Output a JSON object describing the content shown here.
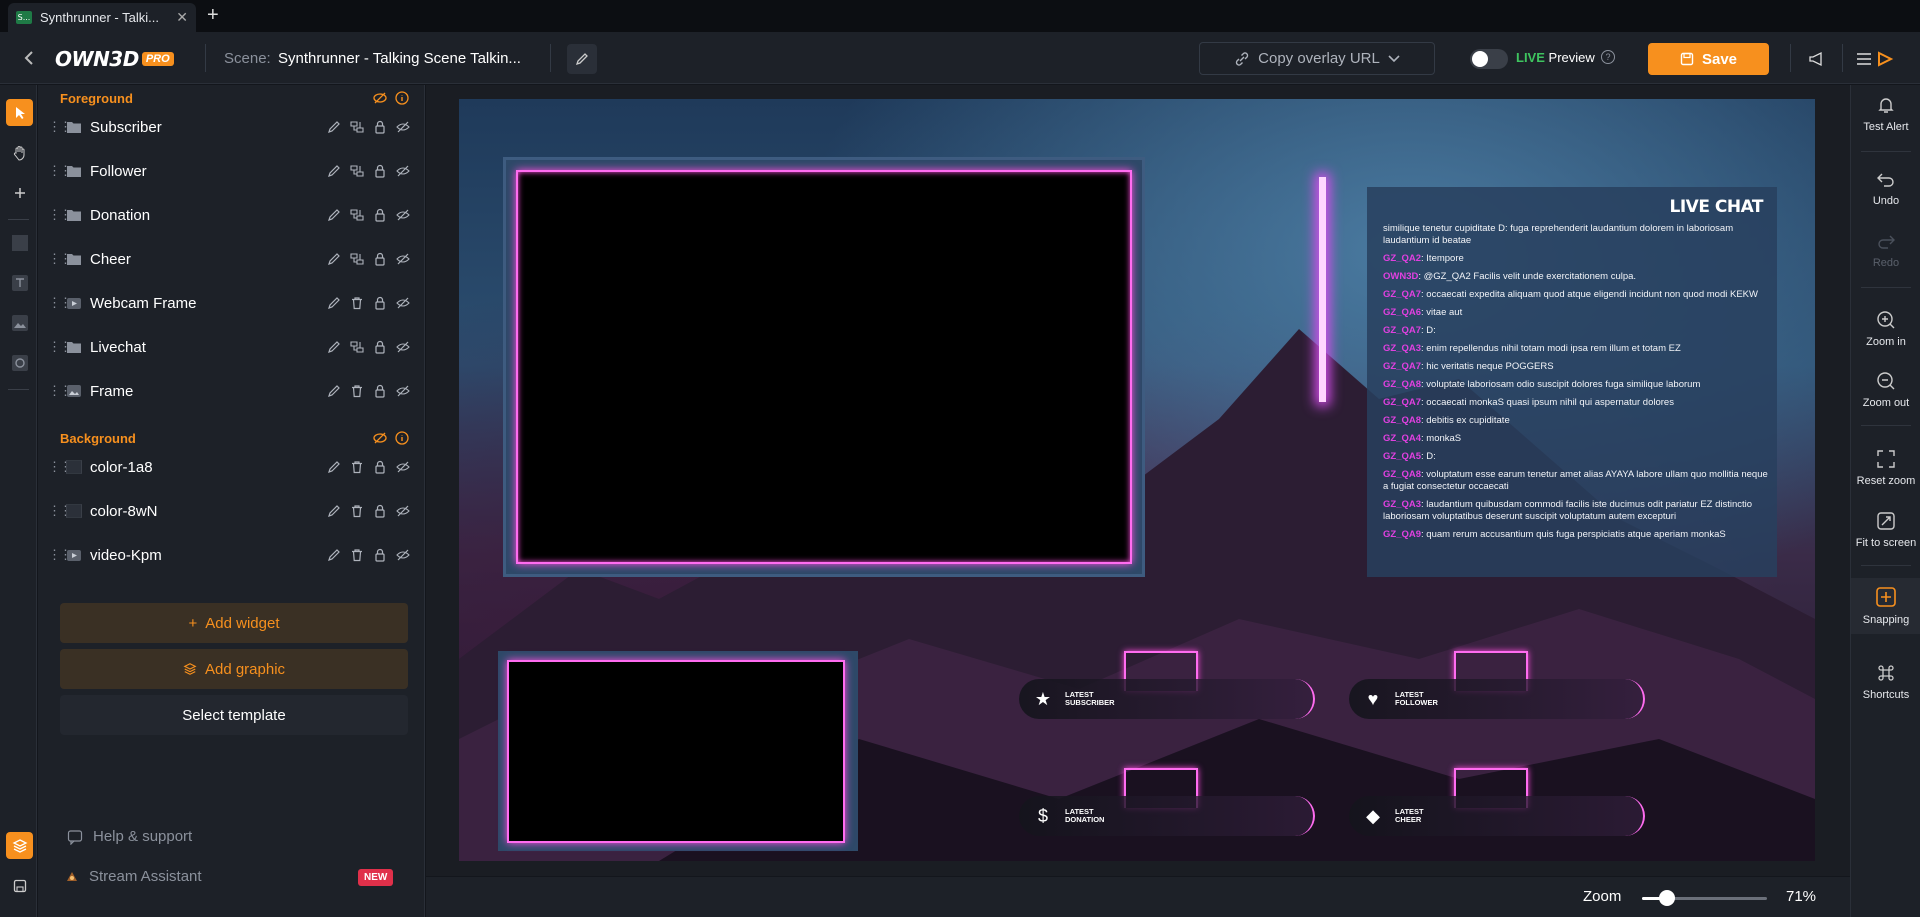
{
  "browser": {
    "tab_favicon": "S...",
    "tab_title": "Synthrunner - Talki...",
    "close_glyph": "✕",
    "new_tab_glyph": "+"
  },
  "header": {
    "logo_text": "OWN3D",
    "logo_badge": "PRO",
    "scene_label": "Scene:",
    "scene_name": "Synthrunner - Talking Scene Talkin...",
    "copy_url_label": "Copy overlay URL",
    "live_word": "LIVE",
    "preview_word": "Preview",
    "save_label": "Save"
  },
  "layers": {
    "foreground_title": "Foreground",
    "background_title": "Background",
    "foreground_items": [
      {
        "name": "Subscriber",
        "icon": "folder-icon"
      },
      {
        "name": "Follower",
        "icon": "folder-icon"
      },
      {
        "name": "Donation",
        "icon": "folder-icon"
      },
      {
        "name": "Cheer",
        "icon": "folder-icon"
      },
      {
        "name": "Webcam Frame",
        "icon": "video-icon"
      },
      {
        "name": "Livechat",
        "icon": "folder-icon"
      },
      {
        "name": "Frame",
        "icon": "image-icon"
      }
    ],
    "background_items": [
      {
        "name": "color-1a8",
        "icon": "color-swatch-icon"
      },
      {
        "name": "color-8wN",
        "icon": "color-swatch-icon"
      },
      {
        "name": "video-Kpm",
        "icon": "video-icon"
      }
    ],
    "add_widget_label": "Add widget",
    "add_graphic_label": "Add graphic",
    "select_template_label": "Select template",
    "help_label": "Help & support",
    "assistant_label": "Stream Assistant",
    "new_badge": "NEW"
  },
  "canvas": {
    "chat_title": "LIVE CHAT",
    "chat_lines": [
      {
        "user": "",
        "text": "similique tenetur cupiditate D: fuga reprehenderit laudantium dolorem in laboriosam laudantium id beatae"
      },
      {
        "user": "GZ_QA2",
        "text": ": Itempore"
      },
      {
        "user": "OWN3D",
        "text": ": @GZ_QA2 Facilis velit unde exercitationem culpa."
      },
      {
        "user": "GZ_QA7",
        "text": ": occaecati expedita aliquam quod atque eligendi incidunt non quod modi KEKW"
      },
      {
        "user": "GZ_QA6",
        "text": ": vitae aut"
      },
      {
        "user": "GZ_QA7",
        "text": ": D:"
      },
      {
        "user": "GZ_QA3",
        "text": ": enim repellendus nihil totam modi ipsa rem illum et totam EZ"
      },
      {
        "user": "GZ_QA7",
        "text": ": hic veritatis neque POGGERS"
      },
      {
        "user": "GZ_QA8",
        "text": ": voluptate laboriosam odio suscipit dolores fuga similique laborum"
      },
      {
        "user": "GZ_QA7",
        "text": ": occaecati monkaS quasi ipsum nihil qui aspernatur dolores"
      },
      {
        "user": "GZ_QA8",
        "text": ": debitis ex cupiditate"
      },
      {
        "user": "GZ_QA4",
        "text": ": monkaS"
      },
      {
        "user": "GZ_QA5",
        "text": ": D:"
      },
      {
        "user": "GZ_QA8",
        "text": ": voluptatum esse earum tenetur amet alias AYAYA labore ullam quo mollitia neque a fugiat consectetur occaecati"
      },
      {
        "user": "GZ_QA3",
        "text": ": laudantium quibusdam commodi facilis iste ducimus odit pariatur EZ distinctio laboriosam voluptatibus deserunt suscipit voluptatum autem excepturi"
      },
      {
        "user": "GZ_QA9",
        "text": ": quam rerum accusantium quis fuga perspiciatis atque aperiam monkaS"
      }
    ],
    "alerts": [
      {
        "line1": "LATEST",
        "line2": "SUBSCRIBER",
        "icon": "star-icon",
        "glyph": "★"
      },
      {
        "line1": "LATEST",
        "line2": "FOLLOWER",
        "icon": "heart-icon",
        "glyph": "♥"
      },
      {
        "line1": "LATEST",
        "line2": "DONATION",
        "icon": "dollar-icon",
        "glyph": "$"
      },
      {
        "line1": "LATEST",
        "line2": "CHEER",
        "icon": "diamond-icon",
        "glyph": "◆"
      }
    ]
  },
  "zoom": {
    "label": "Zoom",
    "value": "71%",
    "level": 0.2
  },
  "rightbar": {
    "test_alert": "Test Alert",
    "undo": "Undo",
    "redo": "Redo",
    "zoom_in": "Zoom in",
    "zoom_out": "Zoom out",
    "reset_zoom": "Reset zoom",
    "fit_to_screen": "Fit to screen",
    "snapping": "Snapping",
    "shortcuts": "Shortcuts"
  },
  "colors": {
    "accent": "#f7901e",
    "neon": "#ff6cf0",
    "live_green": "#3ec45f"
  }
}
